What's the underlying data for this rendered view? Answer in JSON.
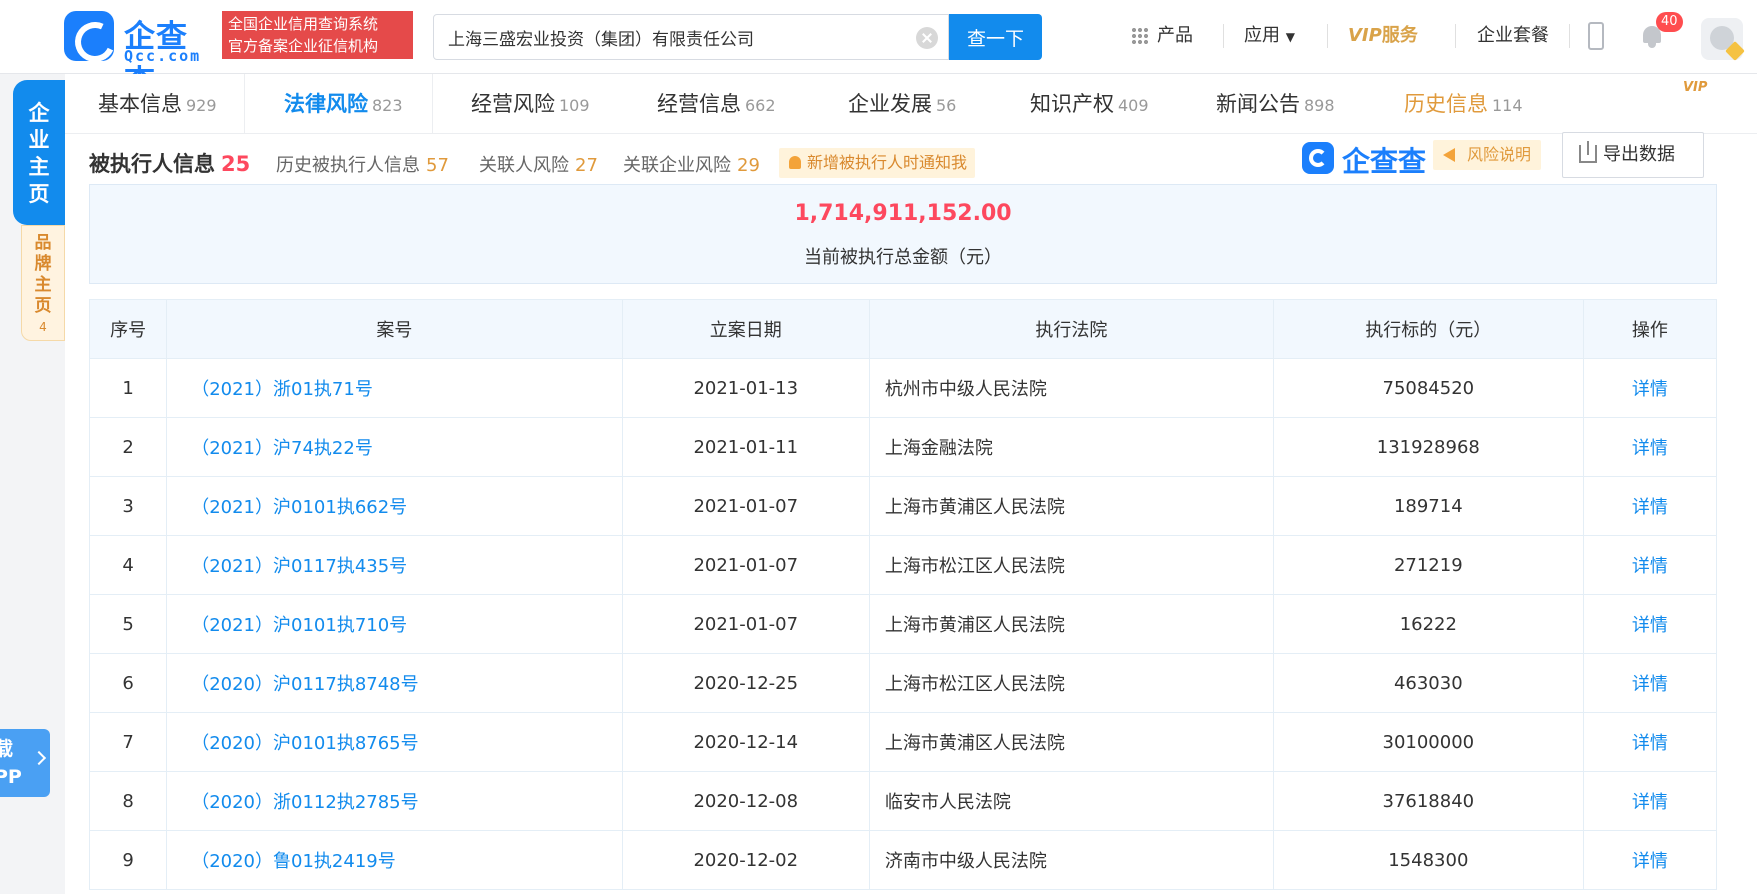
{
  "header": {
    "logo_cn": "企查查",
    "logo_en": "Qcc.com",
    "slogan_line1": "全国企业信用查询系统",
    "slogan_line2": "官方备案企业征信机构",
    "search_value": "上海三盛宏业投资（集团）有限责任公司",
    "search_button": "查一下",
    "nav_product": "产品",
    "nav_apps": "应用",
    "nav_vip_a": "VIP",
    "nav_vip_b": "服务",
    "nav_package": "企业套餐",
    "notification_count": "40"
  },
  "side": {
    "main_tab": [
      "企",
      "业",
      "主",
      "页"
    ],
    "brand_tab": [
      "品",
      "牌",
      "主",
      "页"
    ],
    "brand_count": "4",
    "download_line1": "载",
    "download_line2": "PP"
  },
  "tabs": [
    {
      "label": "基本信息",
      "count": "929"
    },
    {
      "label": "法律风险",
      "count": "823"
    },
    {
      "label": "经营风险",
      "count": "109"
    },
    {
      "label": "经营信息",
      "count": "662"
    },
    {
      "label": "企业发展",
      "count": "56"
    },
    {
      "label": "知识产权",
      "count": "409"
    },
    {
      "label": "新闻公告",
      "count": "898"
    },
    {
      "label": "历史信息",
      "count": "114"
    }
  ],
  "tab_vip": "VIP",
  "section": {
    "title": "被执行人信息",
    "count": "25",
    "links": [
      {
        "label": "历史被执行人信息",
        "count": "57"
      },
      {
        "label": "关联人风险",
        "count": "27"
      },
      {
        "label": "关联企业风险",
        "count": "29"
      }
    ],
    "notify": "新增被执行人时通知我",
    "brand": "企查查",
    "risk_tip": "风险说明",
    "export": "导出数据"
  },
  "summary": {
    "amount": "1,714,911,152.00",
    "label": "当前被执行总金额（元）"
  },
  "table": {
    "headers": [
      "序号",
      "案号",
      "立案日期",
      "执行法院",
      "执行标的（元）",
      "操作"
    ],
    "rows": [
      {
        "no": "1",
        "case": "（2021）浙01执71号",
        "date": "2021-01-13",
        "court": "杭州市中级人民法院",
        "amount": "75084520",
        "op": "详情"
      },
      {
        "no": "2",
        "case": "（2021）沪74执22号",
        "date": "2021-01-11",
        "court": "上海金融法院",
        "amount": "131928968",
        "op": "详情"
      },
      {
        "no": "3",
        "case": "（2021）沪0101执662号",
        "date": "2021-01-07",
        "court": "上海市黄浦区人民法院",
        "amount": "189714",
        "op": "详情"
      },
      {
        "no": "4",
        "case": "（2021）沪0117执435号",
        "date": "2021-01-07",
        "court": "上海市松江区人民法院",
        "amount": "271219",
        "op": "详情"
      },
      {
        "no": "5",
        "case": "（2021）沪0101执710号",
        "date": "2021-01-07",
        "court": "上海市黄浦区人民法院",
        "amount": "16222",
        "op": "详情"
      },
      {
        "no": "6",
        "case": "（2020）沪0117执8748号",
        "date": "2020-12-25",
        "court": "上海市松江区人民法院",
        "amount": "463030",
        "op": "详情"
      },
      {
        "no": "7",
        "case": "（2020）沪0101执8765号",
        "date": "2020-12-14",
        "court": "上海市黄浦区人民法院",
        "amount": "30100000",
        "op": "详情"
      },
      {
        "no": "8",
        "case": "（2020）浙0112执2785号",
        "date": "2020-12-08",
        "court": "临安市人民法院",
        "amount": "37618840",
        "op": "详情"
      },
      {
        "no": "9",
        "case": "（2020）鲁01执2419号",
        "date": "2020-12-02",
        "court": "济南市中级人民法院",
        "amount": "1548300",
        "op": "详情"
      }
    ]
  }
}
